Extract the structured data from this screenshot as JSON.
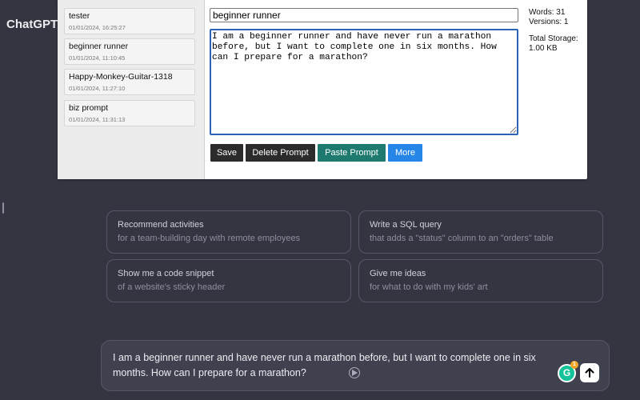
{
  "app": {
    "title": "ChatGPT"
  },
  "prompt_list": [
    {
      "name": "tester",
      "date": "01/01/2024, 16:25:27"
    },
    {
      "name": "beginner runner",
      "date": "01/01/2024, 11:10:45"
    },
    {
      "name": "Happy-Monkey-Guitar-1318",
      "date": "01/01/2024, 11:27:10"
    },
    {
      "name": "biz prompt",
      "date": "01/01/2024, 11:31:13"
    }
  ],
  "editor": {
    "title_value": "beginner runner",
    "body_value": "I am a beginner runner and have never run a marathon before, but I want to complete one in six months. How can I prepare for a marathon?"
  },
  "stats": {
    "words": "Words: 31",
    "versions": "Versions: 1",
    "storage_label": "Total Storage:",
    "storage_value": "1.00 KB"
  },
  "actions": {
    "save": "Save",
    "delete": "Delete Prompt",
    "paste": "Paste Prompt",
    "more": "More"
  },
  "suggestions": [
    {
      "title": "Recommend activities",
      "subtitle": "for a team-building day with remote employees"
    },
    {
      "title": "Write a SQL query",
      "subtitle": "that adds a \"status\" column to an \"orders\" table"
    },
    {
      "title": "Show me a code snippet",
      "subtitle": "of a website's sticky header"
    },
    {
      "title": "Give me ideas",
      "subtitle": "for what to do with my kids' art"
    }
  ],
  "composer": {
    "text": "I am a beginner runner and have never run a marathon before, but I want to complete one in six months. How can I prepare for a marathon?",
    "grammarly_count": "1"
  },
  "colors": {
    "background": "#343541",
    "paste_button": "#1e7a6e",
    "more_button": "#2586e8",
    "grammarly": "#15c39a"
  }
}
